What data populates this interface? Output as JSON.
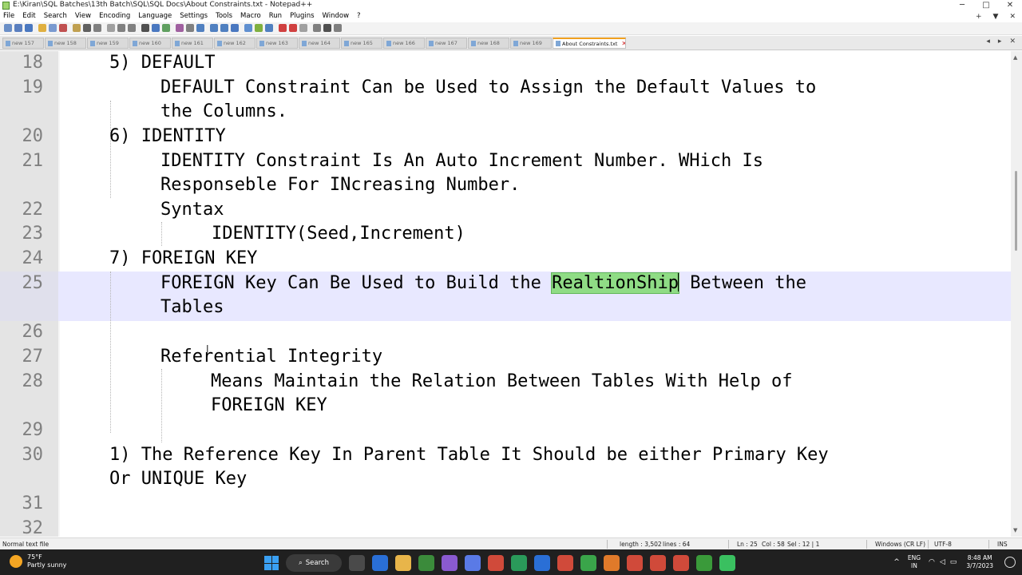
{
  "window": {
    "title": "E:\\Kiran\\SQL Batches\\13th Batch\\SQL\\SQL Docs\\About Constraints.txt - Notepad++",
    "controls": [
      "─",
      "□",
      "✕"
    ]
  },
  "menu": {
    "items": [
      "File",
      "Edit",
      "Search",
      "View",
      "Encoding",
      "Language",
      "Settings",
      "Tools",
      "Macro",
      "Run",
      "Plugins",
      "Window",
      "?"
    ],
    "right": [
      "+",
      "▼",
      "✕"
    ]
  },
  "toolbar": {
    "button_colors": [
      "#6b8fc7",
      "#5a7fbf",
      "#4a78c0",
      "#e0b040",
      "#7a9ad0",
      "#c05050",
      "#c0a050",
      "#606060",
      "#808080",
      "#a0a0a0",
      "#808080",
      "#808080",
      "#505050",
      "#4a78c0",
      "#60a060",
      "#a060a0",
      "#808080",
      "#5080c0",
      "#5080c0",
      "#5080c0",
      "#4a78c0",
      "#6090d0",
      "#80b040",
      "#5080c0",
      "#d04040",
      "#d04040",
      "#a0a0a0",
      "#808080",
      "#505050",
      "#808080"
    ]
  },
  "tabs": {
    "items": [
      "new 157",
      "new 158",
      "new 159",
      "new 160",
      "new 161",
      "new 162",
      "new 163",
      "new 164",
      "new 165",
      "new 166",
      "new 167",
      "new 168",
      "new 169"
    ],
    "active": "About Constraints.txt",
    "arrows": [
      "◂",
      "▸",
      "✕"
    ]
  },
  "editor": {
    "line_numbers": [
      "18",
      "19",
      "20",
      "21",
      "22",
      "23",
      "24",
      "25",
      "26",
      "27",
      "28",
      "29",
      "30",
      "31",
      "32"
    ],
    "lines": {
      "l18": "5) DEFAULT",
      "l19a": "DEFAULT Constraint Can be Used to Assign the Default Values to",
      "l19b": "the Columns.",
      "l20": "6) IDENTITY",
      "l21a": "IDENTITY Constraint Is An Auto Increment Number. WHich Is",
      "l21b": "Responseble For INcreasing Number.",
      "l22": "Syntax",
      "l23": "IDENTITY(Seed,Increment)",
      "l24": "7) FOREIGN KEY",
      "l25a_pre": "FOREIGN Key Can Be Used to Build the ",
      "l25a_match": "RealtionShip",
      "l25a_post": " Between the",
      "l25b": "Tables",
      "l27": "Referential Integrity",
      "l28a": "Means Maintain the Relation Between Tables With Help of",
      "l28b": "FOREIGN KEY",
      "l30a": "1) The Reference Key In Parent Table It Should be either Primary Key",
      "l30b": "Or UNIQUE Key"
    },
    "current_line": 25
  },
  "status": {
    "file_type": "Normal text file",
    "length": "length : 3,502",
    "lines": "lines : 64",
    "ln": "Ln : 25",
    "col": "Col : 58",
    "sel": "Sel : 12 | 1",
    "eol": "Windows (CR LF)",
    "encoding": "UTF-8",
    "mode": "INS"
  },
  "taskbar": {
    "weather_temp": "75°F",
    "weather_desc": "Partly sunny",
    "search_label": "Search",
    "app_icon_colors": [
      "#4a4a4a",
      "#2a6fd6",
      "#e8b54a",
      "#3b8b3b",
      "#8a5ad0",
      "#5a7ae6",
      "#d04a3a",
      "#2a9a5a",
      "#2a6fd6",
      "#d04a3a",
      "#3aa54a",
      "#e07a2a",
      "#d04a3a",
      "#d04a3a",
      "#d04a3a",
      "#3a9a3a",
      "#3ac060"
    ],
    "tray_chevron": "^",
    "lang_top": "ENG",
    "lang_bottom": "IN",
    "time": "8:48 AM",
    "date": "3/7/2023"
  }
}
